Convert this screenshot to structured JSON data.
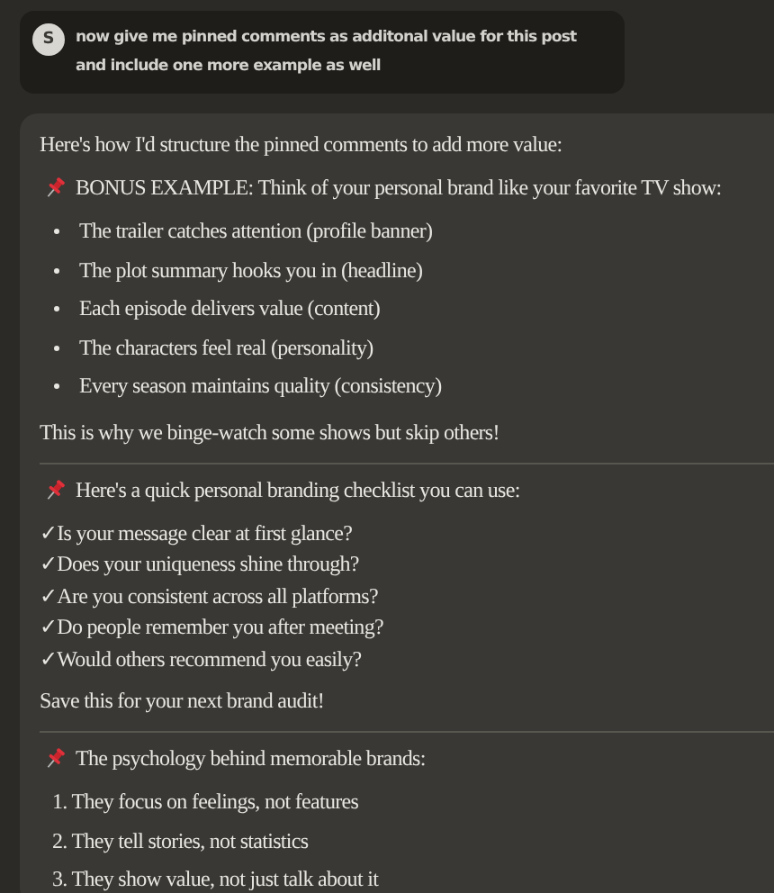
{
  "user_message": {
    "avatar": "S",
    "text_lines": [
      "now give me pinned comments as additonal value for this post",
      "and include one more example as well"
    ]
  },
  "response": {
    "blocks": [
      {
        "kind": "paragraph",
        "text": "Here's how I'd structure the pinned comments to add more value:"
      },
      {
        "kind": "pinned",
        "text": "BONUS EXAMPLE: Think of your personal brand like your favorite TV show:"
      },
      {
        "kind": "bullets",
        "items": [
          "The trailer catches attention (profile banner)",
          "The plot summary hooks you in (headline)",
          "Each episode delivers value (content)",
          "The characters feel real (personality)",
          "Every season maintains quality (consistency)"
        ]
      },
      {
        "kind": "paragraph",
        "text": "This is why we binge-watch some shows but skip others!"
      },
      {
        "kind": "divider"
      },
      {
        "kind": "pinned",
        "text": "Here's a quick personal branding checklist you can use:"
      },
      {
        "kind": "checks",
        "items": [
          {
            "mark": "✓",
            "text": "Is your message clear at first glance?"
          },
          {
            "mark": "✓",
            "text": "Does your uniqueness shine through?"
          },
          {
            "mark": "✓",
            "text": "Are you consistent across all platforms?"
          },
          {
            "mark": "✓",
            "text": "Do people remember you after meeting?"
          },
          {
            "mark": "✓",
            "text": "Would others recommend you easily?"
          }
        ]
      },
      {
        "kind": "paragraph",
        "text": "Save this for your next brand audit!"
      },
      {
        "kind": "divider"
      },
      {
        "kind": "pinned",
        "text": "The psychology behind memorable brands:"
      },
      {
        "kind": "numbered",
        "items": [
          {
            "number": "1.",
            "text": "They focus on feelings, not features"
          },
          {
            "number": "2.",
            "text": "They tell stories, not statistics"
          },
          {
            "number": "3.",
            "text": "They show value, not just talk about it"
          }
        ]
      }
    ]
  }
}
